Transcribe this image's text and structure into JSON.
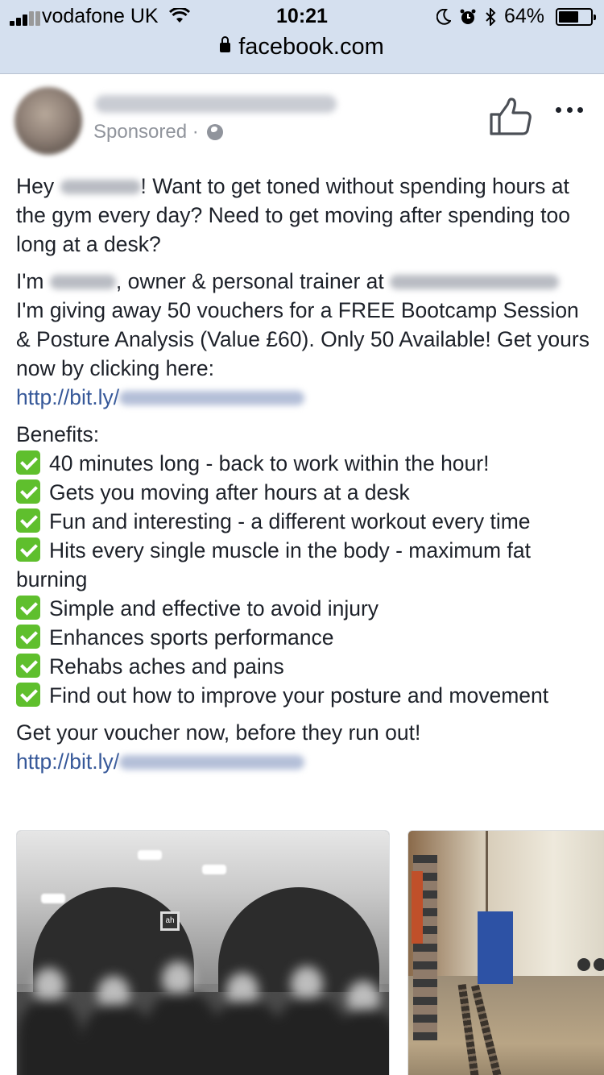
{
  "status_bar": {
    "carrier": "vodafone UK",
    "time": "10:21",
    "battery_percent": "64%",
    "battery_level": 0.64,
    "icons": [
      "signal-icon",
      "wifi-icon",
      "moon-icon",
      "alarm-icon",
      "bluetooth-icon",
      "battery-icon"
    ]
  },
  "browser": {
    "url": "facebook.com",
    "lock_icon": "lock-icon"
  },
  "post": {
    "sponsored_label": "Sponsored",
    "sponsored_separator": " · ",
    "icons": {
      "privacy": "globe-icon",
      "like": "thumbs-up-icon",
      "more": "more-options-icon"
    },
    "para1_hey": "Hey ",
    "para1_rest": "! Want to get toned without spending hours at the gym every day? Need to get moving after spending too long at a desk?",
    "para2_im": "I'm ",
    "para2_mid": ", owner & personal trainer at",
    "para2_rest": "I'm giving away 50 vouchers for a FREE Bootcamp Session & Posture Analysis (Value £60). Only 50 Available! Get yours now by clicking here:",
    "link_prefix": "http://bit.ly/",
    "benefits_title": "Benefits:",
    "benefits": [
      "40 minutes long - back to work within the hour!",
      "Gets you moving after hours at a desk",
      "Fun and interesting - a different workout every time",
      "Hits every single muscle in the body - maximum fat burning",
      "Simple and effective to avoid injury",
      "Enhances sports performance",
      "Rehabs aches and pains",
      "Find out how to improve your posture and movement"
    ],
    "closing": "Get your voucher now, before they run out!",
    "closing_link_prefix": "http://bit.ly/"
  },
  "colors": {
    "link": "#365899",
    "text": "#1d2129",
    "muted": "#90949c",
    "check_green": "#5fbf2d",
    "url_bar": "#d5e0ef"
  }
}
